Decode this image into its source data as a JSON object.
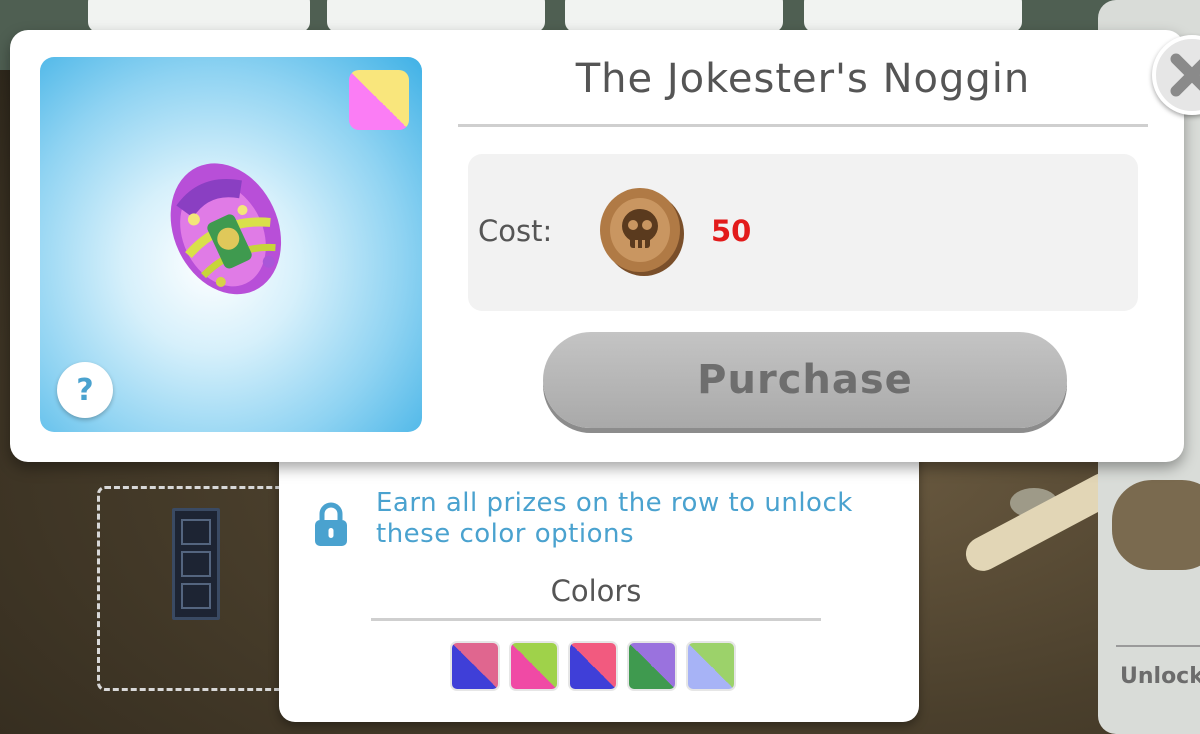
{
  "item": {
    "title": "The Jokester's Noggin",
    "selected_color": [
      "#fb7df5",
      "#f9e67c"
    ],
    "help_label": "?"
  },
  "cost": {
    "label": "Cost:",
    "value": "50",
    "currency_icon": "skull-coin-icon",
    "value_color": "#e21b1b"
  },
  "purchase": {
    "label": "Purchase",
    "enabled": false
  },
  "close_icon": "close-icon",
  "colors_panel": {
    "unlock_message": "Earn all prizes on the row to unlock these color options",
    "title": "Colors",
    "swatches": [
      {
        "a": "#e0668f",
        "b": "#3f3fd8"
      },
      {
        "a": "#9fd24a",
        "b": "#f04aa5"
      },
      {
        "a": "#f25a7f",
        "b": "#3f3fd8"
      },
      {
        "a": "#9a72de",
        "b": "#3f9a4f"
      },
      {
        "a": "#9cd26a",
        "b": "#a7b3f6"
      }
    ]
  },
  "background": {
    "right_card_label": "Unlock"
  }
}
